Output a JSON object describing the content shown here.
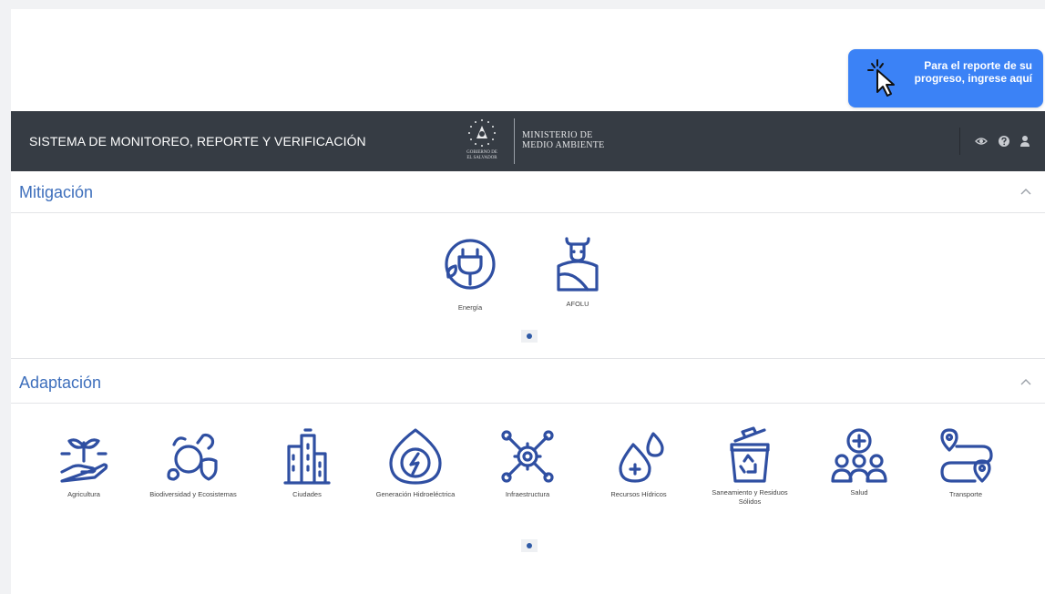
{
  "report_button": {
    "label": "Para el reporte de su progreso, ingrese aquí"
  },
  "header": {
    "system_title": "SISTEMA DE MONITOREO, REPORTE Y VERIFICACIÓN",
    "gov_label_1": "GOBIERNO DE",
    "gov_label_2": "EL SALVADOR",
    "ministry_line1": "MINISTERIO DE",
    "ministry_line2": "MEDIO AMBIENTE",
    "icons": [
      "eye-icon",
      "help-icon",
      "user-icon"
    ]
  },
  "mitigation": {
    "title": "Mitigación",
    "items": [
      {
        "label": "Energía",
        "icon": "energy-plug-icon"
      },
      {
        "label": "AFOLU",
        "icon": "afolu-cow-field-icon"
      }
    ]
  },
  "adaptation": {
    "title": "Adaptación",
    "items": [
      {
        "label": "Agricultura",
        "icon": "agriculture-plant-hand-icon"
      },
      {
        "label": "Biodiversidad y Ecosistemas",
        "icon": "biodiversity-icon"
      },
      {
        "label": "Ciudades",
        "icon": "city-buildings-icon"
      },
      {
        "label": "Generación Hidroeléctrica",
        "icon": "hydro-drop-energy-icon"
      },
      {
        "label": "Infraestructura",
        "icon": "infrastructure-gear-icon"
      },
      {
        "label": "Recursos Hídricos",
        "icon": "water-drops-icon"
      },
      {
        "label": "Saneamiento y Residuos Sólidos",
        "icon": "recycle-bin-icon"
      },
      {
        "label": "Salud",
        "icon": "health-people-icon"
      },
      {
        "label": "Transporte",
        "icon": "transport-route-icon"
      }
    ]
  },
  "colors": {
    "header_bg": "#363c44",
    "accent": "#3b82f6",
    "section_title": "#3e6fbc",
    "icon_blue": "#2f4fa2"
  }
}
